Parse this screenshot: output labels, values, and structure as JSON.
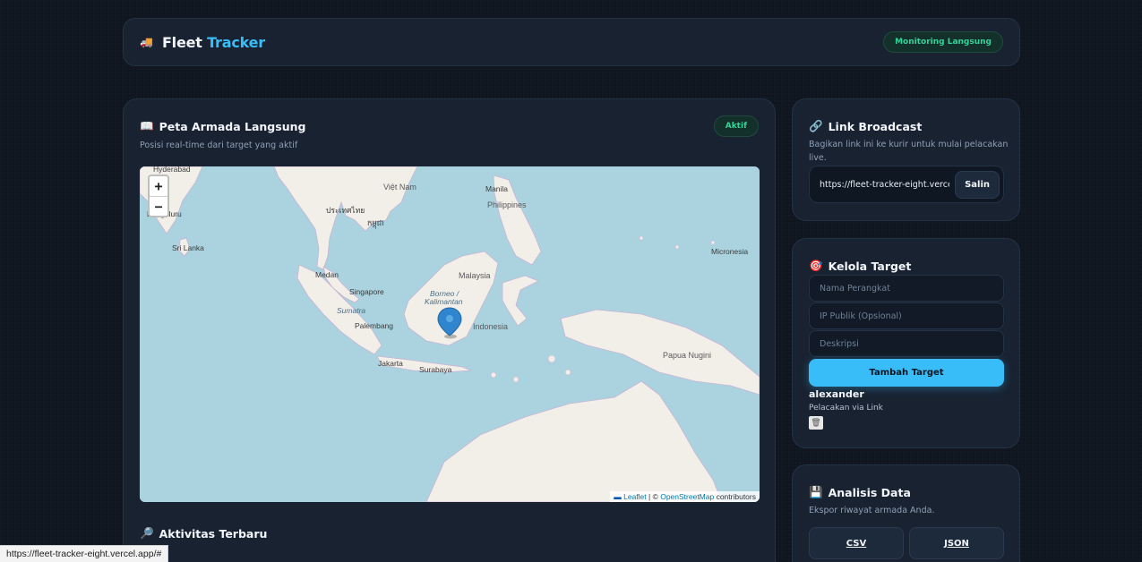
{
  "header": {
    "icon": "truck-icon",
    "title_part1": "Fleet ",
    "title_part2": "Tracker",
    "badge": "Monitoring Langsung"
  },
  "map_card": {
    "icon": "map-book-icon",
    "title": "Peta Armada Langsung",
    "subtitle": "Posisi real-time dari target yang aktif",
    "badge": "Aktif",
    "zoom_in": "+",
    "zoom_out": "−",
    "attribution_flag": "▬",
    "attribution_leaflet": "Leaflet",
    "attribution_sep": " | © ",
    "attribution_osm": "OpenStreetMap",
    "attribution_tail": " contributors",
    "labels": {
      "hyderabad": "Hyderabad",
      "bengaluru": "Bengaluru",
      "sri_lanka": "Sri Lanka",
      "viet_nam": "Việt Nam",
      "khmer": "កម្ពុជា",
      "us_inlu": "ประเทศไทย",
      "manila": "Manila",
      "philippines": "Philippines",
      "medan": "Medan",
      "malaysia": "Malaysia",
      "singapore": "Singapore",
      "sumatra": "Sumatra",
      "borneo": "Borneo /",
      "kalimantan": "Kalimantan",
      "palembang": "Palembang",
      "indonesia": "Indonesia",
      "jakarta": "Jakarta",
      "surabaya": "Surabaya",
      "papua": "Papua Nugini",
      "micronesia": "Micronesia",
      "thai_label": "ประเทศไทย",
      "cambodia_label": "កម្ពុជា"
    },
    "activity_icon": "magnifier-icon",
    "activity_title": "Aktivitas Terbaru"
  },
  "broadcast": {
    "icon": "link-icon",
    "title": "Link Broadcast",
    "subtitle": "Bagikan link ini ke kurir untuk mulai pelacakan live.",
    "url": "https://fleet-tracker-eight.vercel.app/track",
    "copy_label": "Salin"
  },
  "target": {
    "icon": "target-icon",
    "title": "Kelola Target",
    "device_placeholder": "Nama Perangkat",
    "ip_placeholder": "IP Publik (Opsional)",
    "desc_placeholder": "Deskripsi",
    "add_label": "Tambah Target",
    "items": [
      {
        "name": "alexander",
        "method": "Pelacakan via Link"
      }
    ]
  },
  "analysis": {
    "icon": "floppy-disk-icon",
    "title": "Analisis Data",
    "subtitle": "Ekspor riwayat armada Anda.",
    "csv_label": "CSV",
    "json_label": "JSON"
  },
  "statusbar": {
    "url": "https://fleet-tracker-eight.vercel.app/#"
  },
  "colors": {
    "accent": "#38bdf8",
    "live": "#34d399",
    "card": "#182231",
    "background": "#0f1620"
  }
}
